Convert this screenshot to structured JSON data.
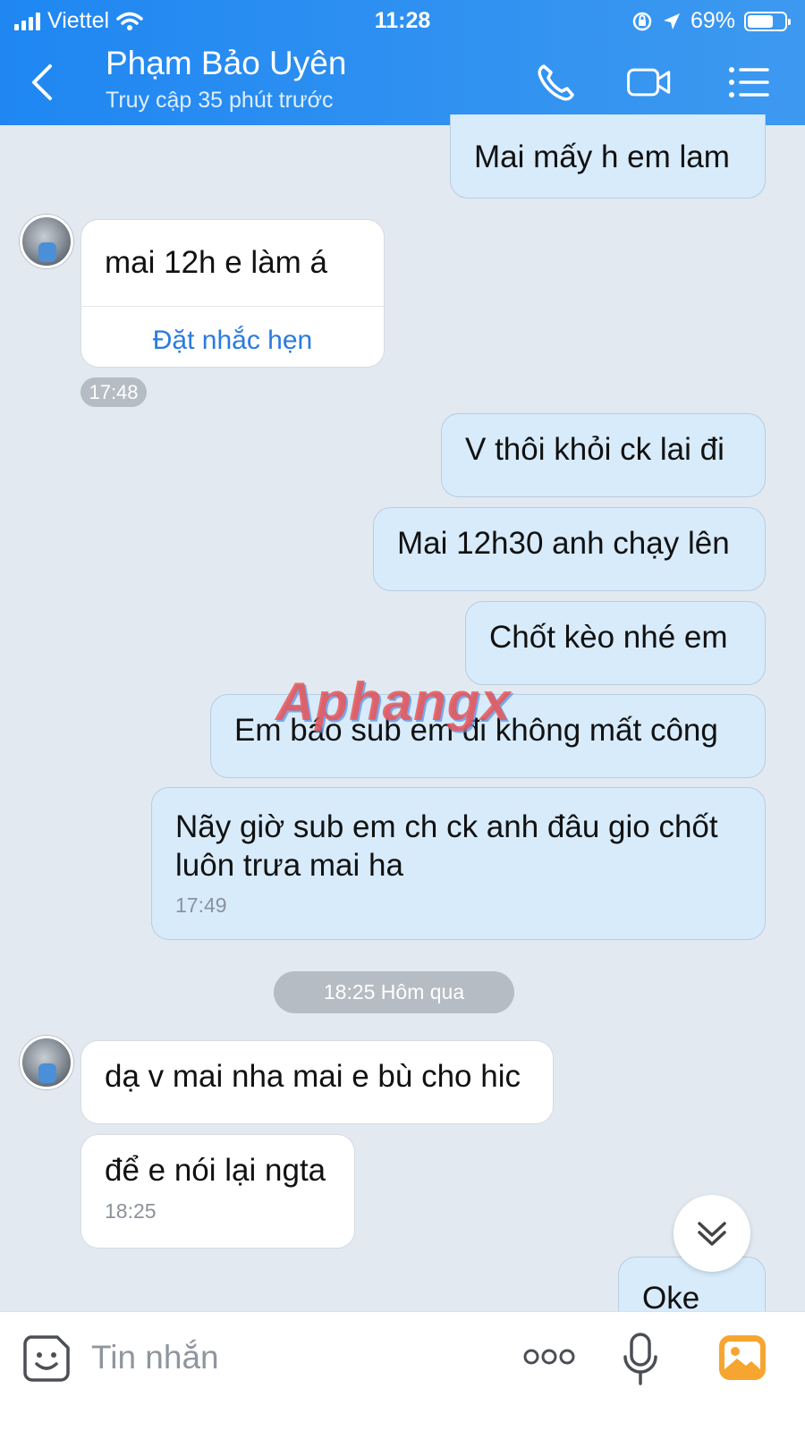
{
  "status_bar": {
    "carrier": "Viettel",
    "time": "11:28",
    "battery": "69%",
    "battery_level": 0.69
  },
  "header": {
    "contact_name": "Phạm Bảo Uyên",
    "last_seen": "Truy cập 35 phút trước",
    "accent": "#2a8bf2"
  },
  "messages": {
    "m1": {
      "text": "Mai mấy h em lam"
    },
    "m2": {
      "text": "mai 12h e làm á",
      "reminder": "Đặt nhắc hẹn",
      "time": "17:48"
    },
    "m3": {
      "text": "V thôi khỏi ck lai đi"
    },
    "m4": {
      "text": "Mai 12h30 anh chạy lên"
    },
    "m5": {
      "text": "Chốt kèo nhé em"
    },
    "m6": {
      "text": "Em báo sub em đi không mất công"
    },
    "m7": {
      "text": "Nãy giờ sub em ch ck anh đâu gio chốt luôn trưa mai ha",
      "time": "17:49"
    },
    "date_separator": "18:25 Hôm qua",
    "m8": {
      "text": "dạ v mai nha mai e bù cho hic"
    },
    "m9": {
      "text": "để e nói lại ngta",
      "time": "18:25"
    },
    "m10": {
      "text": "Oke"
    }
  },
  "watermark": "Aphangx",
  "input": {
    "placeholder": "Tin nhắn"
  },
  "icons": {
    "back": "chevron-left-icon",
    "call": "phone-icon",
    "video": "video-call-icon",
    "menu": "menu-list-icon",
    "sticker": "sticker-emoji-icon",
    "more": "more-dots-icon",
    "mic": "microphone-icon",
    "image": "image-gallery-icon",
    "scroll_down": "chevron-double-down-icon"
  }
}
